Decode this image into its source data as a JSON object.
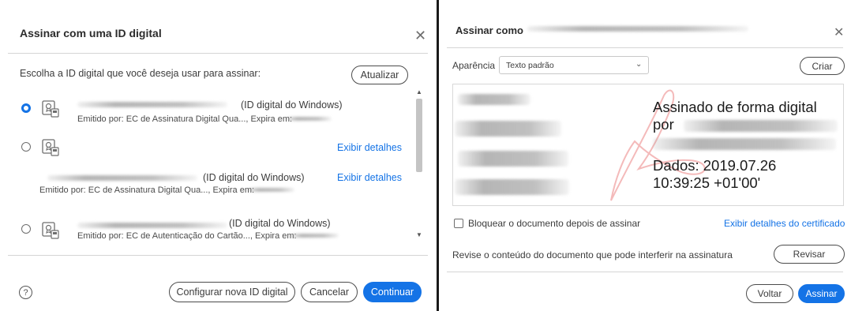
{
  "left_dialog": {
    "title": "Assinar com uma ID digital",
    "instruction": "Escolha a ID digital que você deseja usar para assinar:",
    "refresh_label": "Atualizar",
    "ids": [
      {
        "type": "(ID digital do Windows)",
        "issuer": "Emitido por: EC de Assinatura Digital Qua..., Expira em:",
        "selected": true
      },
      {
        "details_link": "Exibir detalhes",
        "selected": false
      },
      {
        "type": "(ID digital do Windows)",
        "details_link": "Exibir detalhes",
        "issuer": "Emitido por: EC de Assinatura Digital Qua..., Expira em:"
      },
      {
        "type": "(ID digital do Windows)",
        "issuer": "Emitido por: EC de Autenticação do Cartão..., Expira em:",
        "selected": false
      }
    ],
    "help_label": "?",
    "configure_label": "Configurar nova ID digital",
    "cancel_label": "Cancelar",
    "continue_label": "Continuar"
  },
  "right_dialog": {
    "title": "Assinar como",
    "appearance_label": "Aparência",
    "appearance_value": "Texto padrão",
    "create_label": "Criar",
    "signature_preview": {
      "line1": "Assinado de forma digital",
      "line2": "por",
      "line3": "Dados: 2019.07.26",
      "line4": "10:39:25 +01'00'"
    },
    "lock_label": "Bloquear o documento depois de assinar",
    "cert_details_link": "Exibir detalhes do certificado",
    "review_text": "Revise o conteúdo do documento que pode interferir na assinatura",
    "review_label": "Revisar",
    "back_label": "Voltar",
    "sign_label": "Assinar"
  },
  "colors": {
    "accent": "#1473e6",
    "text": "#2c2c2c",
    "divider": "#1a1a1a"
  },
  "icons": [
    "close-icon",
    "certificate-icon",
    "chevron-down-icon",
    "help-icon",
    "scroll-up-icon",
    "scroll-down-icon"
  ]
}
